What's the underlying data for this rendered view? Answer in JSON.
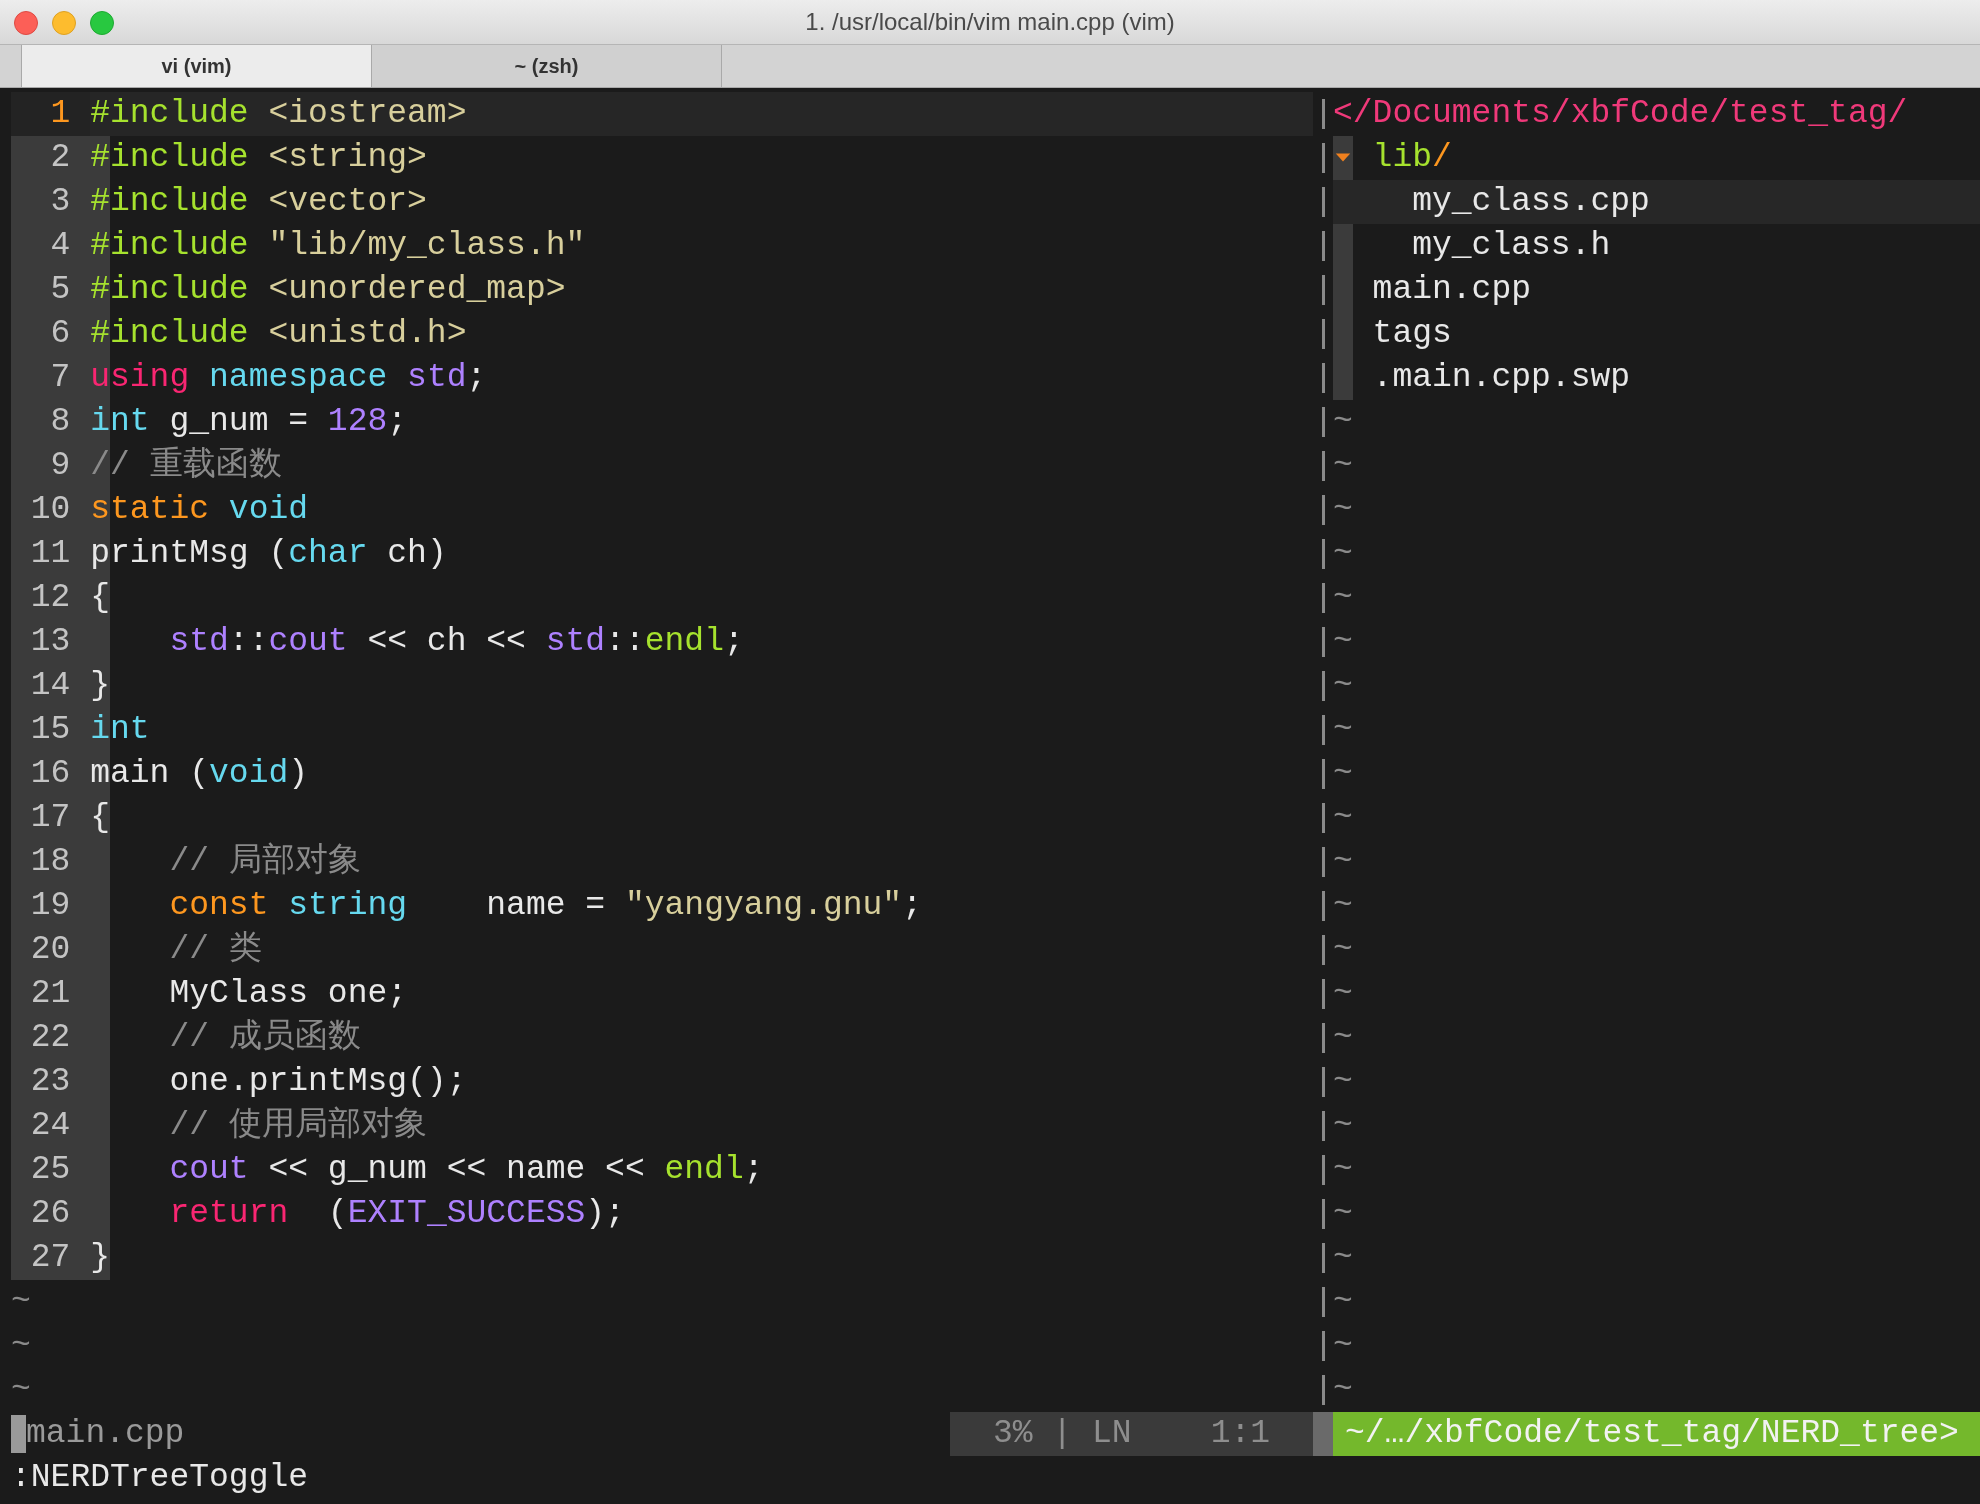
{
  "window": {
    "title": "1. /usr/local/bin/vim main.cpp (vim)"
  },
  "tabs": [
    {
      "label": "vi (vim)",
      "selected": true
    },
    {
      "label": "~ (zsh)",
      "selected": false
    }
  ],
  "editor": {
    "lines": [
      {
        "number": "1",
        "cursor_line": true,
        "tokens": [
          {
            "text": "#include ",
            "kind": "preproc"
          },
          {
            "text": "<iostream>",
            "kind": "string"
          }
        ]
      },
      {
        "number": "2",
        "cursor_line": false,
        "tokens": [
          {
            "text": "#include ",
            "kind": "preproc"
          },
          {
            "text": "<string>",
            "kind": "string"
          }
        ]
      },
      {
        "number": "3",
        "cursor_line": false,
        "tokens": [
          {
            "text": "#include ",
            "kind": "preproc"
          },
          {
            "text": "<vector>",
            "kind": "string"
          }
        ]
      },
      {
        "number": "4",
        "cursor_line": false,
        "tokens": [
          {
            "text": "#include ",
            "kind": "preproc"
          },
          {
            "text": "\"lib/my_class.h\"",
            "kind": "string"
          }
        ]
      },
      {
        "number": "5",
        "cursor_line": false,
        "tokens": [
          {
            "text": "#include ",
            "kind": "preproc"
          },
          {
            "text": "<unordered_map>",
            "kind": "string"
          }
        ]
      },
      {
        "number": "6",
        "cursor_line": false,
        "tokens": [
          {
            "text": "#include ",
            "kind": "preproc"
          },
          {
            "text": "<unistd.h>",
            "kind": "string"
          }
        ]
      },
      {
        "number": "7",
        "cursor_line": false,
        "tokens": [
          {
            "text": "using ",
            "kind": "keyword"
          },
          {
            "text": "namespace ",
            "kind": "type"
          },
          {
            "text": "std",
            "kind": "constant"
          },
          {
            "text": ";",
            "kind": "plain"
          }
        ]
      },
      {
        "number": "8",
        "cursor_line": false,
        "tokens": [
          {
            "text": "int",
            "kind": "type"
          },
          {
            "text": " g_num = ",
            "kind": "plain"
          },
          {
            "text": "128",
            "kind": "constant"
          },
          {
            "text": ";",
            "kind": "plain"
          }
        ]
      },
      {
        "number": "9",
        "cursor_line": false,
        "tokens": [
          {
            "text": "// 重载函数",
            "kind": "comment"
          }
        ]
      },
      {
        "number": "10",
        "cursor_line": false,
        "tokens": [
          {
            "text": "static ",
            "kind": "storage"
          },
          {
            "text": "void",
            "kind": "type"
          }
        ]
      },
      {
        "number": "11",
        "cursor_line": false,
        "tokens": [
          {
            "text": "printMsg (",
            "kind": "plain"
          },
          {
            "text": "char",
            "kind": "type"
          },
          {
            "text": " ch)",
            "kind": "plain"
          }
        ]
      },
      {
        "number": "12",
        "cursor_line": false,
        "tokens": [
          {
            "text": "{",
            "kind": "plain"
          }
        ]
      },
      {
        "number": "13",
        "cursor_line": false,
        "tokens": [
          {
            "text": "    std",
            "kind": "constant"
          },
          {
            "text": "::",
            "kind": "plain"
          },
          {
            "text": "cout",
            "kind": "constant"
          },
          {
            "text": " << ch << ",
            "kind": "plain"
          },
          {
            "text": "std",
            "kind": "constant"
          },
          {
            "text": "::",
            "kind": "plain"
          },
          {
            "text": "endl",
            "kind": "preproc"
          },
          {
            "text": ";",
            "kind": "plain"
          }
        ]
      },
      {
        "number": "14",
        "cursor_line": false,
        "tokens": [
          {
            "text": "}",
            "kind": "plain"
          }
        ]
      },
      {
        "number": "15",
        "cursor_line": false,
        "tokens": [
          {
            "text": "int",
            "kind": "type"
          }
        ]
      },
      {
        "number": "16",
        "cursor_line": false,
        "tokens": [
          {
            "text": "main (",
            "kind": "plain"
          },
          {
            "text": "void",
            "kind": "type"
          },
          {
            "text": ")",
            "kind": "plain"
          }
        ]
      },
      {
        "number": "17",
        "cursor_line": false,
        "tokens": [
          {
            "text": "{",
            "kind": "plain"
          }
        ]
      },
      {
        "number": "18",
        "cursor_line": false,
        "tokens": [
          {
            "text": "    // 局部对象",
            "kind": "comment"
          }
        ]
      },
      {
        "number": "19",
        "cursor_line": false,
        "tokens": [
          {
            "text": "    const ",
            "kind": "storage"
          },
          {
            "text": "string",
            "kind": "type"
          },
          {
            "text": "    name = ",
            "kind": "plain"
          },
          {
            "text": "\"yangyang.gnu\"",
            "kind": "string"
          },
          {
            "text": ";",
            "kind": "plain"
          }
        ]
      },
      {
        "number": "20",
        "cursor_line": false,
        "tokens": [
          {
            "text": "    // 类",
            "kind": "comment"
          }
        ]
      },
      {
        "number": "21",
        "cursor_line": false,
        "tokens": [
          {
            "text": "    MyClass one;",
            "kind": "plain"
          }
        ]
      },
      {
        "number": "22",
        "cursor_line": false,
        "tokens": [
          {
            "text": "    // 成员函数",
            "kind": "comment"
          }
        ]
      },
      {
        "number": "23",
        "cursor_line": false,
        "tokens": [
          {
            "text": "    one.printMsg();",
            "kind": "plain"
          }
        ]
      },
      {
        "number": "24",
        "cursor_line": false,
        "tokens": [
          {
            "text": "    // 使用局部对象",
            "kind": "comment"
          }
        ]
      },
      {
        "number": "25",
        "cursor_line": false,
        "tokens": [
          {
            "text": "    cout",
            "kind": "constant"
          },
          {
            "text": " << g_num << name << ",
            "kind": "plain"
          },
          {
            "text": "endl",
            "kind": "preproc"
          },
          {
            "text": ";",
            "kind": "plain"
          }
        ]
      },
      {
        "number": "26",
        "cursor_line": false,
        "tokens": [
          {
            "text": "    return",
            "kind": "keyword"
          },
          {
            "text": "  (",
            "kind": "plain"
          },
          {
            "text": "EXIT_SUCCESS",
            "kind": "constant"
          },
          {
            "text": ");",
            "kind": "plain"
          }
        ]
      },
      {
        "number": "27",
        "cursor_line": false,
        "tokens": [
          {
            "text": "}",
            "kind": "plain"
          }
        ]
      }
    ],
    "filler_lines": [
      "~",
      "~",
      "~"
    ]
  },
  "tree": {
    "root": "</Documents/xbfCode/test_tag/",
    "items": [
      {
        "name": "lib",
        "suffix": "/",
        "kind": "dir",
        "expanded": true,
        "selected": false,
        "children": [
          {
            "name": "my_class.cpp",
            "selected": true
          },
          {
            "name": "my_class.h",
            "selected": false
          }
        ]
      },
      {
        "name": "main.cpp",
        "selected": false
      },
      {
        "name": "tags",
        "selected": false
      },
      {
        "name": ".main.cpp.swp",
        "selected": false
      }
    ],
    "filler_lines": [
      "~",
      "~",
      "~",
      "~",
      "~",
      "~",
      "~",
      "~",
      "~",
      "~",
      "~",
      "~",
      "~",
      "~",
      "~",
      "~",
      "~",
      "~",
      "~",
      "~",
      "~",
      "~",
      "~"
    ]
  },
  "status_line": {
    "file": "main.cpp",
    "position": "3% | LN    1:1",
    "tree_path": "~/…/xbfCode/test_tag/NERD_tree>"
  },
  "command_line": ":NERDTreeToggle"
}
